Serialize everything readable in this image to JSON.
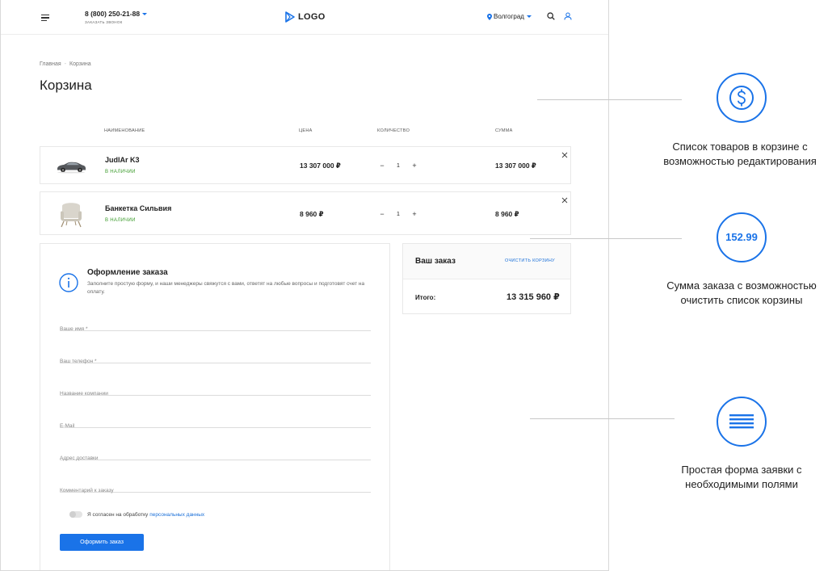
{
  "header": {
    "phone": "8 (800) 250-21-88",
    "callback": "заказать звонок",
    "logo": "LOGO",
    "city": "Волгоград"
  },
  "breadcrumb": [
    "Главная",
    "Корзина"
  ],
  "page_title": "Корзина",
  "columns": {
    "name": "наименование",
    "price": "цена",
    "quantity": "количество",
    "sum": "сумма"
  },
  "items": [
    {
      "name": "JudlAr K3",
      "stock": "в наличии",
      "price": "13 307 000 ₽",
      "qty": "1",
      "sum": "13 307 000 ₽",
      "thumb": "car-image"
    },
    {
      "name": "Банкетка Сильвия",
      "stock": "в наличии",
      "price": "8 960 ₽",
      "qty": "1",
      "sum": "8 960 ₽",
      "thumb": "armchair-image"
    }
  ],
  "form": {
    "title": "Оформление заказа",
    "description": "Заполните простую форму, и наши менеджеры свяжутся с вами, ответят на любые вопросы и подготовят счет на оплату.",
    "fields": [
      {
        "placeholder": "Ваше имя *"
      },
      {
        "placeholder": "Ваш телефон *"
      },
      {
        "placeholder": "Название компании"
      },
      {
        "placeholder": "E-Mail"
      },
      {
        "placeholder": "Адрес доставки"
      },
      {
        "placeholder": "Комментарий к заказу"
      }
    ],
    "consent_text": "Я согласен на обработку",
    "consent_link": "персональных данных",
    "submit": "Оформить заказ"
  },
  "order": {
    "title": "Ваш заказ",
    "clear": "очистить корзину",
    "total_label": "Итого:",
    "total_value": "13 315 960 ₽"
  },
  "annotations": [
    {
      "icon": "dollar-icon",
      "text_line1": "Список товаров в корзине с",
      "text_line2": "возможностью редактирования"
    },
    {
      "icon": "number-badge",
      "value": "152.99",
      "text_line1": "Сумма заказа с возможностью",
      "text_line2": "очистить список корзины"
    },
    {
      "icon": "form-lines-icon",
      "text_line1": "Простая форма заявки с",
      "text_line2": "необходимыми полями"
    }
  ],
  "colors": {
    "accent": "#1a73e8",
    "stock": "#3a9a2a"
  }
}
